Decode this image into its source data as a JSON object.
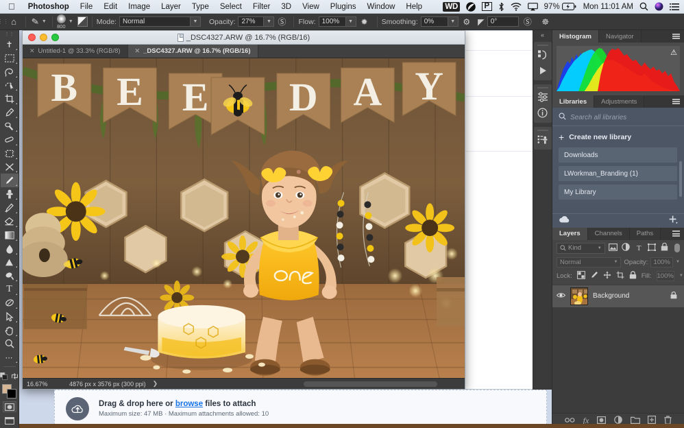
{
  "menubar": {
    "apple_icon": "apple-icon",
    "items": [
      {
        "label": "Photoshop",
        "bold": true
      },
      {
        "label": "File",
        "bold": false
      },
      {
        "label": "Edit",
        "bold": false
      },
      {
        "label": "Image",
        "bold": false
      },
      {
        "label": "Layer",
        "bold": false
      },
      {
        "label": "Type",
        "bold": false
      },
      {
        "label": "Select",
        "bold": false
      },
      {
        "label": "Filter",
        "bold": false
      },
      {
        "label": "3D",
        "bold": false
      },
      {
        "label": "View",
        "bold": false
      },
      {
        "label": "Plugins",
        "bold": false
      },
      {
        "label": "Window",
        "bold": false
      },
      {
        "label": "Help",
        "bold": false
      }
    ],
    "status": {
      "wd_badge": "WD",
      "creative_cloud_icon": "creative-cloud-icon",
      "p_badge": "P",
      "bluetooth_icon": "bluetooth-icon",
      "wifi_icon": "wifi-icon",
      "airplay_icon": "airplay-icon",
      "battery_percent": "97%",
      "battery_icon": "battery-charging-icon",
      "clock": "Mon 11:01 AM",
      "spotlight_icon": "search-icon",
      "siri_icon": "siri-icon",
      "control_center_icon": "control-center-icon"
    }
  },
  "options_bar": {
    "home_icon": "home-icon",
    "brush_preset_icon": "brush-icon",
    "brush_size": "800",
    "brush_tip_icon": "brush-tip-icon",
    "mode_label": "Mode:",
    "mode_value": "Normal",
    "opacity_label": "Opacity:",
    "opacity_value": "27%",
    "pressure_opacity_icon": "pressure-opacity-icon",
    "flow_label": "Flow:",
    "flow_value": "100%",
    "airbrush_icon": "airbrush-icon",
    "smoothing_label": "Smoothing:",
    "smoothing_value": "0%",
    "smoothing_options_icon": "gear-icon",
    "angle_icon": "angle-icon",
    "angle_value": "0°",
    "pressure_size_icon": "pressure-size-icon",
    "symmetry_icon": "symmetry-butterfly-icon"
  },
  "toolbar": {
    "tools": [
      {
        "name": "move-tool",
        "glyph": "✥",
        "active": false
      },
      {
        "name": "rectangular-marquee-tool",
        "glyph": "▭",
        "active": false
      },
      {
        "name": "lasso-tool",
        "glyph": "𝒮",
        "active": false
      },
      {
        "name": "object-selection-tool",
        "glyph": "◠",
        "active": false
      },
      {
        "name": "crop-tool",
        "glyph": "⌗",
        "active": false
      },
      {
        "name": "eyedropper-tool",
        "glyph": "✐",
        "active": false
      },
      {
        "name": "spot-healing-brush-tool",
        "glyph": "❧",
        "active": false
      },
      {
        "name": "patch-tool",
        "glyph": "▬",
        "active": false
      },
      {
        "name": "content-aware-move-tool",
        "glyph": "▦",
        "active": false
      },
      {
        "name": "red-eye-tool",
        "glyph": "✂",
        "active": false
      },
      {
        "name": "brush-tool",
        "glyph": "🖌",
        "active": true
      },
      {
        "name": "clone-stamp-tool",
        "glyph": "♟",
        "active": false
      },
      {
        "name": "history-brush-tool",
        "glyph": "✎",
        "active": false
      },
      {
        "name": "eraser-tool",
        "glyph": "◣",
        "active": false
      },
      {
        "name": "gradient-tool",
        "glyph": "▤",
        "active": false
      },
      {
        "name": "blur-tool",
        "glyph": "💧",
        "active": false
      },
      {
        "name": "dodge-tool",
        "glyph": "▲",
        "active": false
      },
      {
        "name": "pen-tool",
        "glyph": "✒",
        "active": false
      },
      {
        "name": "type-tool",
        "glyph": "T",
        "active": false
      },
      {
        "name": "path-selection-tool",
        "glyph": "◌",
        "active": false
      },
      {
        "name": "direct-selection-tool",
        "glyph": "➤",
        "active": false
      },
      {
        "name": "hand-tool",
        "glyph": "✋",
        "active": false
      },
      {
        "name": "zoom-tool",
        "glyph": "🔍",
        "active": false
      },
      {
        "name": "edit-toolbar-button",
        "glyph": "•••",
        "active": false
      }
    ],
    "foreground_color": "#d6b694",
    "background_color": "#000000",
    "quick_mask_icon": "quick-mask-icon"
  },
  "document_window": {
    "title": "_DSC4327.ARW @ 16.7% (RGB/16)",
    "tabs": [
      {
        "label": "Untitled-1 @ 33.3% (RGB/8)",
        "active": false
      },
      {
        "label": "_DSC4327.ARW @ 16.7% (RGB/16)",
        "active": true
      }
    ],
    "status": {
      "zoom": "16.67%",
      "dimensions": "4876 px x 3576 px (300 ppi)",
      "expand_arrow": "❯"
    },
    "image_description": "BEE DAY first birthday cake smash photo"
  },
  "dock_rail": {
    "collapse_icon": "double-chevron-left-icon",
    "icons": [
      {
        "name": "history-panel-icon",
        "glyph": "🕘"
      },
      {
        "name": "actions-play-icon",
        "glyph": "▶"
      },
      {
        "name": "properties-sliders-icon",
        "glyph": "⚟"
      },
      {
        "name": "info-panel-icon",
        "glyph": "ⓘ"
      },
      {
        "name": "clone-source-icon",
        "glyph": "⎘"
      }
    ]
  },
  "panels": {
    "histogram": {
      "tabs": [
        {
          "label": "Histogram",
          "active": true
        },
        {
          "label": "Navigator",
          "active": false
        }
      ],
      "warning_icon": "uncached-data-warning-icon",
      "menu_icon": "panel-menu-icon"
    },
    "libraries": {
      "tabs": [
        {
          "label": "Libraries",
          "active": true
        },
        {
          "label": "Adjustments",
          "active": false
        }
      ],
      "menu_icon": "panel-menu-icon",
      "search_icon": "search-icon",
      "search_placeholder": "Search all libraries",
      "create_label": "Create new library",
      "items": [
        {
          "label": "Downloads"
        },
        {
          "label": "LWorkman_Branding (1)"
        },
        {
          "label": "My Library"
        }
      ],
      "footer": {
        "cloud_icon": "cloud-icon",
        "add_icon": "add-content-icon"
      }
    },
    "layers": {
      "tabs": [
        {
          "label": "Layers",
          "active": true
        },
        {
          "label": "Channels",
          "active": false
        },
        {
          "label": "Paths",
          "active": false
        }
      ],
      "menu_icon": "panel-menu-icon",
      "filter": {
        "search_icon": "search-icon",
        "kind_label": "Kind",
        "icons": [
          {
            "name": "filter-pixel-icon",
            "glyph": "▣"
          },
          {
            "name": "filter-adjustment-icon",
            "glyph": "◑"
          },
          {
            "name": "filter-type-icon",
            "glyph": "T"
          },
          {
            "name": "filter-shape-icon",
            "glyph": "▱"
          },
          {
            "name": "filter-smart-object-icon",
            "glyph": "▤"
          }
        ],
        "toggle": "filter-enable-toggle"
      },
      "blend_mode": "Normal",
      "opacity_label": "Opacity:",
      "opacity_value": "100%",
      "lock_label": "Lock:",
      "lock_icons": [
        {
          "name": "lock-transparent-pixels-icon",
          "glyph": "▩"
        },
        {
          "name": "lock-image-pixels-icon",
          "glyph": "🖌"
        },
        {
          "name": "lock-position-icon",
          "glyph": "✥"
        },
        {
          "name": "lock-artboard-nesting-icon",
          "glyph": "⌗"
        },
        {
          "name": "lock-all-icon",
          "glyph": "🔒"
        }
      ],
      "fill_label": "Fill:",
      "fill_value": "100%",
      "rows": [
        {
          "name": "Background",
          "visible_icon": "eye-icon",
          "locked_icon": "lock-icon"
        }
      ],
      "footer_icons": [
        {
          "name": "link-layers-icon",
          "glyph": "⚭"
        },
        {
          "name": "layer-style-fx-icon",
          "glyph": "fx"
        },
        {
          "name": "add-layer-mask-icon",
          "glyph": "◉"
        },
        {
          "name": "new-adjustment-layer-icon",
          "glyph": "◐"
        },
        {
          "name": "new-group-icon",
          "glyph": "🗀"
        },
        {
          "name": "new-layer-icon",
          "glyph": "⊞"
        },
        {
          "name": "delete-layer-icon",
          "glyph": "🗑"
        }
      ]
    }
  },
  "dropzone": {
    "upload_icon": "upload-cloud-icon",
    "text_prefix": "Drag & drop here or ",
    "link_label": "browse",
    "text_suffix": " files to attach",
    "hint": "Maximum size: 47 MB · Maximum attachments allowed: 10"
  },
  "colors": {
    "accent_link": "#1473e6",
    "panel_bg": "#454545",
    "libraries_bg": "#4c5665",
    "options_bar_bg": "#393939"
  }
}
